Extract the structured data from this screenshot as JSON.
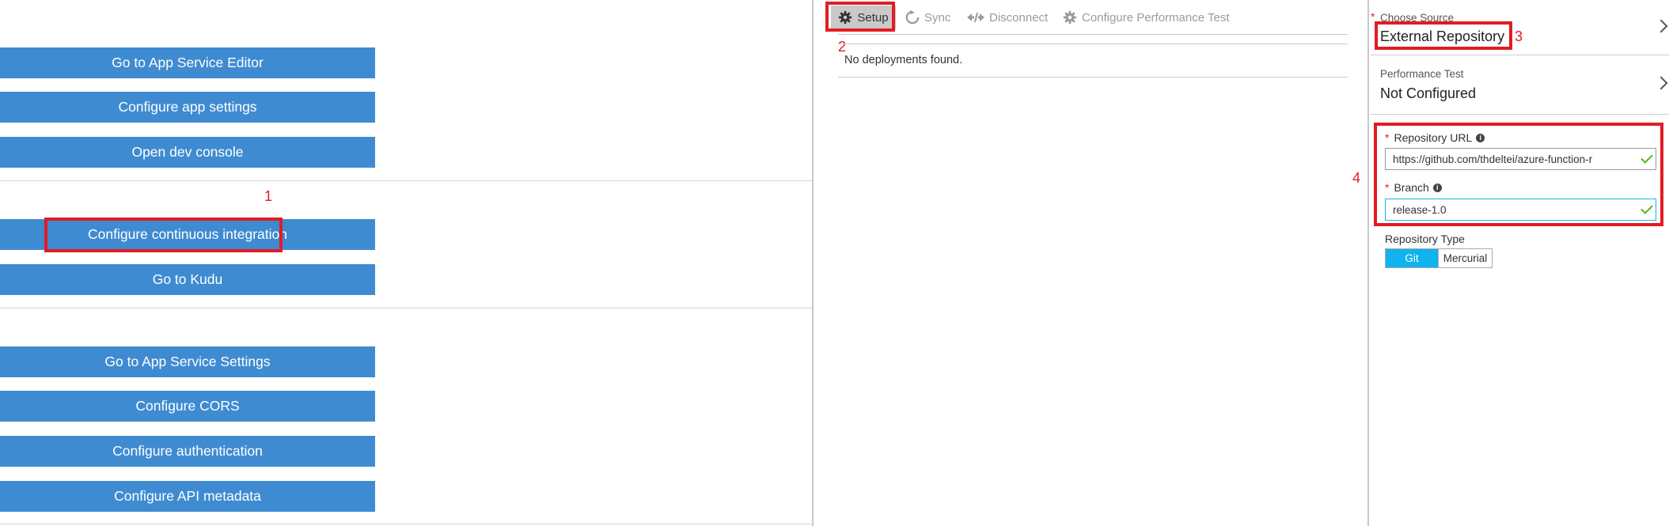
{
  "left": {
    "buttons_group1": [
      {
        "label": "Go to App Service Editor"
      },
      {
        "label": "Configure app settings"
      },
      {
        "label": "Open dev console"
      }
    ],
    "buttons_group2": [
      {
        "label": "Configure continuous integration"
      },
      {
        "label": "Go to Kudu"
      }
    ],
    "buttons_group3": [
      {
        "label": "Go to App Service Settings"
      },
      {
        "label": "Configure CORS"
      },
      {
        "label": "Configure authentication"
      },
      {
        "label": "Configure API metadata"
      }
    ]
  },
  "toolbar": {
    "setup_label": "Setup",
    "sync_label": "Sync",
    "disconnect_label": "Disconnect",
    "perf_label": "Configure Performance Test"
  },
  "deployments": {
    "empty_message": "No deployments found."
  },
  "right": {
    "choose_source": {
      "label": "Choose Source",
      "value": "External Repository",
      "required_mark": "*"
    },
    "performance_test": {
      "label": "Performance Test",
      "value": "Not Configured"
    },
    "repo_url": {
      "label": "Repository URL",
      "value": "https://github.com/thdeltei/azure-function-r",
      "required_mark": "*"
    },
    "branch": {
      "label": "Branch",
      "value": "release-1.0",
      "required_mark": "*"
    },
    "repo_type": {
      "label": "Repository Type",
      "options": [
        "Git",
        "Mercurial"
      ],
      "selected": "Git"
    }
  },
  "annotations": {
    "n1": "1",
    "n2": "2",
    "n3": "3",
    "n4": "4"
  },
  "colors": {
    "button_blue": "#3f8bd1",
    "annotation_red": "#e11c24",
    "toggle_selected": "#0fb3ee",
    "valid_green": "#5cb21a"
  },
  "icons": {
    "setup": "gear-icon",
    "sync": "sync-icon",
    "disconnect": "disconnect-icon",
    "perf": "gear-icon",
    "info": "info-icon",
    "chevron": "chevron-right-icon",
    "check": "check-icon"
  }
}
